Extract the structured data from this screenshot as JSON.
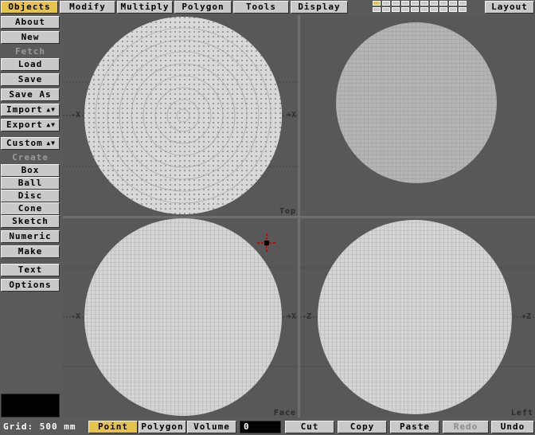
{
  "top_tabs": [
    "Objects",
    "Modify",
    "Multiply",
    "Polygon",
    "Tools",
    "Display"
  ],
  "layout_button": "Layout",
  "sidebar": {
    "about": "About",
    "new": "New",
    "fetch_label": "Fetch",
    "load": "Load",
    "save": "Save",
    "save_as": "Save As",
    "import": "Import",
    "export": "Export",
    "custom": "Custom",
    "create_label": "Create",
    "box": "Box",
    "ball": "Ball",
    "disc": "Disc",
    "cone": "Cone",
    "sketch": "Sketch",
    "numeric": "Numeric",
    "make": "Make",
    "text": "Text",
    "options": "Options"
  },
  "viewports": {
    "top": {
      "label": "Top",
      "axis_left": "X",
      "axis_right": "X"
    },
    "perspective": {
      "label": ""
    },
    "face": {
      "label": "Face",
      "axis_left": "X",
      "axis_right": "X"
    },
    "left": {
      "label": "Left",
      "axis_left": "Z",
      "axis_right": "Z"
    }
  },
  "bottom": {
    "grid": "Grid: 500 mm",
    "point": "Point",
    "polygon": "Polygon",
    "volume": "Volume",
    "count": "0",
    "cut": "Cut",
    "copy": "Copy",
    "paste": "Paste",
    "redo": "Redo",
    "undo": "Undo"
  },
  "colors": {
    "active": "#e6c24e",
    "button": "#c9c9c9",
    "viewport": "#585858"
  }
}
